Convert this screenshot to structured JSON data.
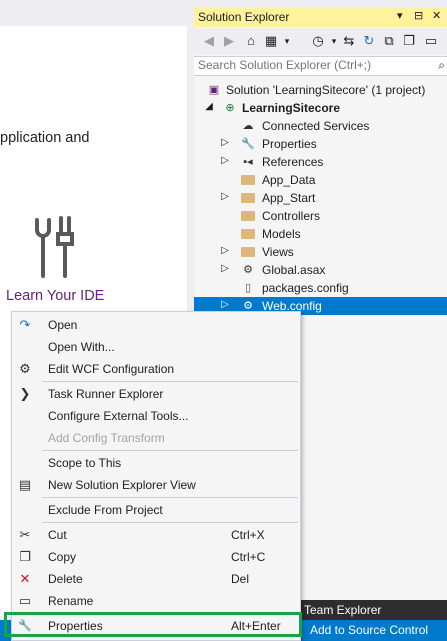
{
  "start_page": {
    "partial_text": "pplication and",
    "learn_label": "Learn Your IDE"
  },
  "solution_explorer": {
    "title": "Solution Explorer",
    "title_buttons": [
      "▾",
      "⊟",
      "✕"
    ],
    "search_placeholder": "Search Solution Explorer (Ctrl+;)",
    "tree": [
      {
        "label": "Solution 'LearningSitecore' (1 project)",
        "icon": "solution-icon",
        "expander": ""
      },
      {
        "label": "LearningSitecore",
        "icon": "web-project-icon",
        "expander": "◢",
        "bold": true
      },
      {
        "label": "Connected Services",
        "icon": "connected-services-icon",
        "expander": ""
      },
      {
        "label": "Properties",
        "icon": "wrench-icon",
        "expander": "▷"
      },
      {
        "label": "References",
        "icon": "references-icon",
        "expander": "▷"
      },
      {
        "label": "App_Data",
        "icon": "folder-icon",
        "expander": ""
      },
      {
        "label": "App_Start",
        "icon": "folder-icon",
        "expander": "▷"
      },
      {
        "label": "Controllers",
        "icon": "folder-icon",
        "expander": ""
      },
      {
        "label": "Models",
        "icon": "folder-icon",
        "expander": ""
      },
      {
        "label": "Views",
        "icon": "folder-icon",
        "expander": "▷"
      },
      {
        "label": "Global.asax",
        "icon": "global-asax-icon",
        "expander": "▷"
      },
      {
        "label": "packages.config",
        "icon": "config-file-icon",
        "expander": ""
      },
      {
        "label": "Web.config",
        "icon": "web-config-icon",
        "expander": "▷",
        "selected": true
      }
    ]
  },
  "context_menu": {
    "items": [
      {
        "label": "Open",
        "shortcut": "",
        "icon": "open-arrow-icon",
        "glyph": "↷"
      },
      {
        "label": "Open With...",
        "shortcut": "",
        "icon": "",
        "glyph": ""
      },
      {
        "label": "Edit WCF Configuration",
        "shortcut": "",
        "icon": "wcf-gear-icon",
        "glyph": "⚙"
      },
      {
        "label": "Task Runner Explorer",
        "shortcut": "",
        "icon": "chevron-right-icon",
        "glyph": "❯"
      },
      {
        "label": "Configure External Tools...",
        "shortcut": "",
        "icon": "",
        "glyph": ""
      },
      {
        "label": "Add Config Transform",
        "shortcut": "",
        "icon": "",
        "glyph": "",
        "disabled": true
      },
      {
        "label": "Scope to This",
        "shortcut": "",
        "icon": "",
        "glyph": ""
      },
      {
        "label": "New Solution Explorer View",
        "shortcut": "",
        "icon": "new-view-icon",
        "glyph": "▤"
      },
      {
        "label": "Exclude From Project",
        "shortcut": "",
        "icon": "",
        "glyph": ""
      },
      {
        "label": "Cut",
        "shortcut": "Ctrl+X",
        "icon": "scissors-icon",
        "glyph": "✂"
      },
      {
        "label": "Copy",
        "shortcut": "Ctrl+C",
        "icon": "copy-icon",
        "glyph": "❐"
      },
      {
        "label": "Delete",
        "shortcut": "Del",
        "icon": "delete-x-icon",
        "glyph": "✕"
      },
      {
        "label": "Rename",
        "shortcut": "",
        "icon": "rename-icon",
        "glyph": "▭"
      },
      {
        "label": "Properties",
        "shortcut": "Alt+Enter",
        "icon": "wrench-icon",
        "glyph": "🔧"
      }
    ]
  },
  "team_explorer_tab": "Team Explorer",
  "status_bar": {
    "source_control": "Add to Source Control"
  },
  "colors": {
    "accent": "#007acc",
    "title_active": "#fff29d",
    "highlight_box": "#1aa24a",
    "delete_red": "#c5162f",
    "learn_purple": "#68217a"
  }
}
